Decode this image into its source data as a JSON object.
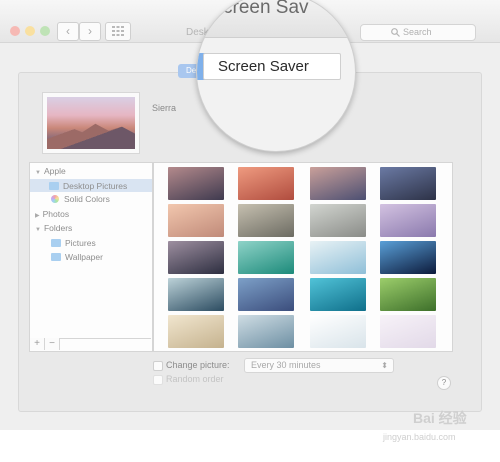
{
  "window": {
    "title": "Desktop & Screen Saver",
    "title_visible": "Desk"
  },
  "toolbar": {
    "back_icon": "chevron-left-icon",
    "forward_icon": "chevron-right-icon",
    "grid_icon": "grid-icon",
    "search_placeholder": "Search"
  },
  "tabs": {
    "desktop_visible": "De",
    "screen_saver": "Screen Saver",
    "screen_saver_title_partial": "creen Sav"
  },
  "preview": {
    "name": "Sierra"
  },
  "sidebar": {
    "items": [
      {
        "label": "Apple",
        "kind": "group"
      },
      {
        "label": "Desktop Pictures",
        "kind": "folder",
        "selected": true
      },
      {
        "label": "Solid Colors",
        "kind": "color"
      },
      {
        "label": "Photos",
        "kind": "group"
      },
      {
        "label": "Folders",
        "kind": "group"
      },
      {
        "label": "Pictures",
        "kind": "folder"
      },
      {
        "label": "Wallpaper",
        "kind": "folder"
      }
    ],
    "add_label": "+",
    "remove_label": "−"
  },
  "thumbnails": [
    [
      "#3f3a4f",
      "#b48a8c"
    ],
    [
      "#b04c3e",
      "#ef9b80"
    ],
    [
      "#4c4f72",
      "#caa09a"
    ],
    [
      "#2d3247",
      "#6b7aa4"
    ],
    [
      "#c08a79",
      "#f2c7ae"
    ],
    [
      "#6c6b62",
      "#c6c0b0"
    ],
    [
      "#8a8c88",
      "#d2d5d0"
    ],
    [
      "#8a79ad",
      "#d3c2e1"
    ],
    [
      "#2d2e40",
      "#9e8fa0"
    ],
    [
      "#1c8a7a",
      "#8fd3c8"
    ],
    [
      "#8fbfd8",
      "#e8f2f5"
    ],
    [
      "#0c1a3b",
      "#5aa0d8"
    ],
    [
      "#2c4c61",
      "#bcd2d8"
    ],
    [
      "#3b4d7c",
      "#7da0c8"
    ],
    [
      "#0f6f8a",
      "#51c3d8"
    ],
    [
      "#3d6f2a",
      "#9cce6b"
    ],
    [
      "#c5b28e",
      "#f1e6cf"
    ],
    [
      "#6d8fa3",
      "#cfdde4"
    ],
    [
      "#d9e4ea",
      "#ffffff"
    ],
    [
      "#e2d9e8",
      "#f7f2f8"
    ]
  ],
  "options": {
    "change_picture_label": "Change picture:",
    "interval_value": "Every 30 minutes",
    "random_order_label": "Random order",
    "help_label": "?"
  },
  "watermark": {
    "brand": "Bai 经验",
    "url": "jingyan.baidu.com"
  }
}
